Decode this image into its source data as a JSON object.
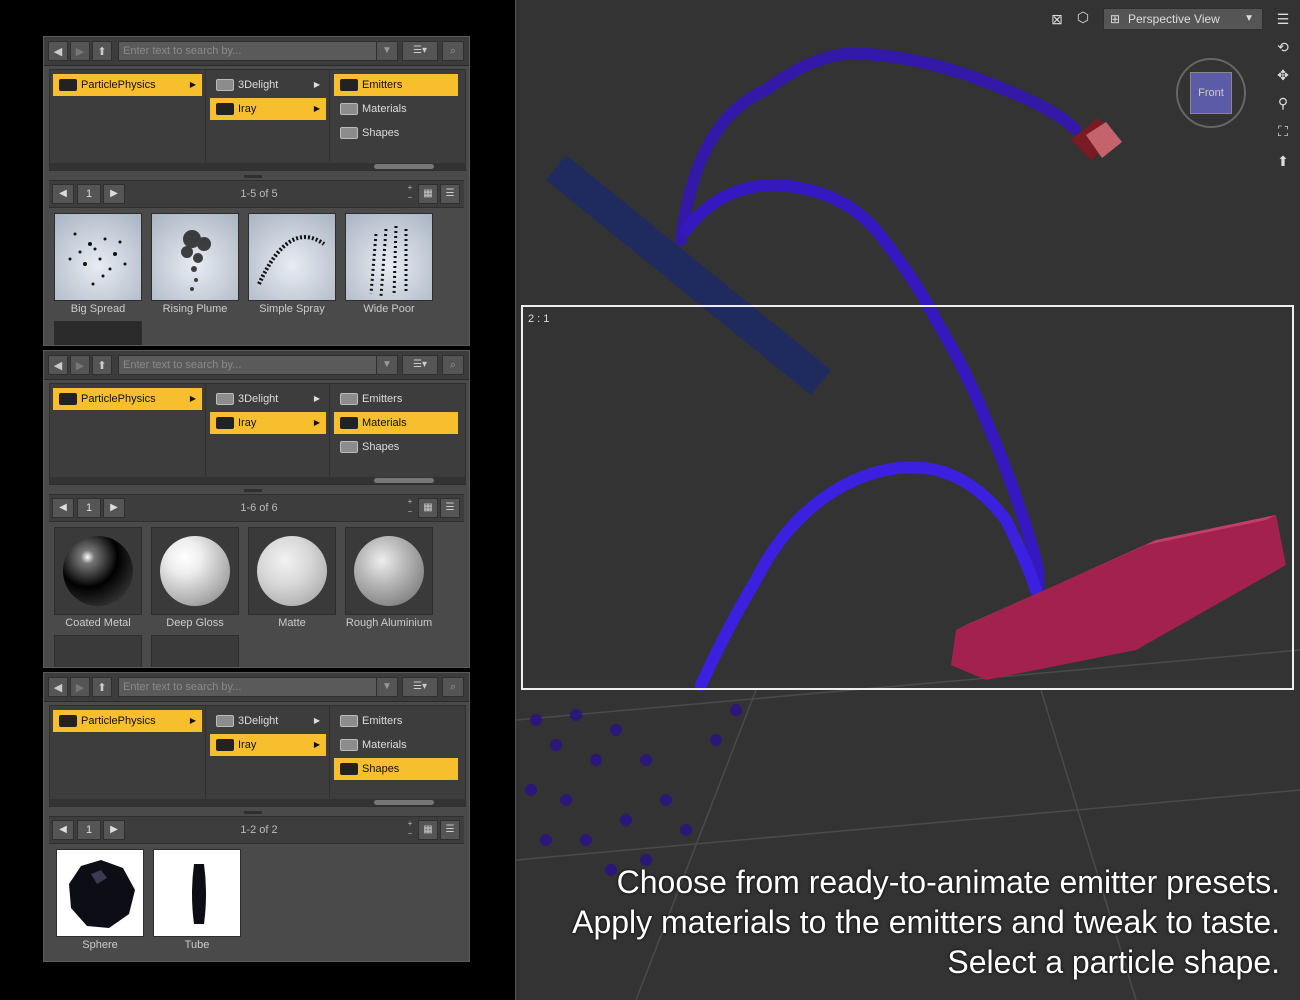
{
  "search": {
    "placeholder": "Enter text to search by..."
  },
  "panels": [
    {
      "tree": {
        "col1": [
          {
            "label": "ParticlePhysics",
            "selected": true
          }
        ],
        "col2": [
          {
            "label": "3Delight",
            "selected": false
          },
          {
            "label": "Iray",
            "selected": true
          }
        ],
        "col3": [
          {
            "label": "Emitters",
            "selected": true
          },
          {
            "label": "Materials",
            "selected": false
          },
          {
            "label": "Shapes",
            "selected": false
          }
        ]
      },
      "pager": {
        "page": "1",
        "count": "1-5 of 5"
      },
      "items": [
        {
          "label": "Big Spread"
        },
        {
          "label": "Rising Plume"
        },
        {
          "label": "Simple Spray"
        },
        {
          "label": "Wide Poor"
        }
      ]
    },
    {
      "tree": {
        "col1": [
          {
            "label": "ParticlePhysics",
            "selected": true
          }
        ],
        "col2": [
          {
            "label": "3Delight",
            "selected": false
          },
          {
            "label": "Iray",
            "selected": true
          }
        ],
        "col3": [
          {
            "label": "Emitters",
            "selected": false
          },
          {
            "label": "Materials",
            "selected": true
          },
          {
            "label": "Shapes",
            "selected": false
          }
        ]
      },
      "pager": {
        "page": "1",
        "count": "1-6 of 6"
      },
      "items": [
        {
          "label": "Coated Metal"
        },
        {
          "label": "Deep Gloss"
        },
        {
          "label": "Matte"
        },
        {
          "label": "Rough Aluminium"
        }
      ]
    },
    {
      "tree": {
        "col1": [
          {
            "label": "ParticlePhysics",
            "selected": true
          }
        ],
        "col2": [
          {
            "label": "3Delight",
            "selected": false
          },
          {
            "label": "Iray",
            "selected": true
          }
        ],
        "col3": [
          {
            "label": "Emitters",
            "selected": false
          },
          {
            "label": "Materials",
            "selected": false
          },
          {
            "label": "Shapes",
            "selected": true
          }
        ]
      },
      "pager": {
        "page": "1",
        "count": "1-2 of 2"
      },
      "items": [
        {
          "label": "Sphere"
        },
        {
          "label": "Tube"
        }
      ]
    }
  ],
  "viewport": {
    "camera": "Perspective View",
    "cube_face": "Front",
    "inset_label": "2 : 1"
  },
  "captions": [
    "Choose from ready-to-animate emitter presets.",
    "Apply materials to the emitters and tweak to taste.",
    "Select a particle shape."
  ],
  "colors": {
    "selected": "#f7be2d",
    "particle": "#3a1fd0",
    "emitter": "#9a2042"
  }
}
